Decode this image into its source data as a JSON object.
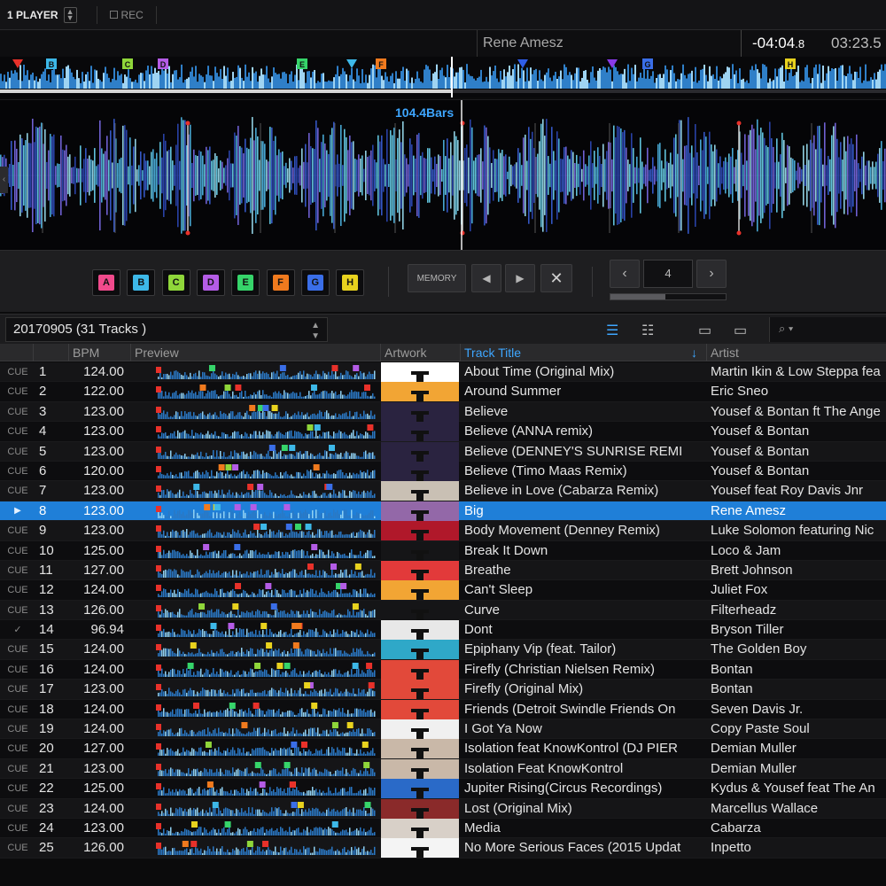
{
  "topbar": {
    "player": "1 PLAYER",
    "rec": "REC"
  },
  "deck": {
    "artist": "Rene Amesz",
    "remaining_main": "-04:04",
    "remaining_frac": ".8",
    "elapsed": "03:23.5",
    "bars_label": "104.4Bars"
  },
  "overview_markers": [
    {
      "label": "",
      "color": "#e8312a",
      "kind": "triangle"
    },
    {
      "label": "B",
      "color": "#3db8e8",
      "kind": "square"
    },
    {
      "label": "C",
      "color": "#8fd63a",
      "kind": "square"
    },
    {
      "label": "D",
      "color": "#b45ce6",
      "kind": "square"
    },
    {
      "label": "E",
      "color": "#36d46a",
      "kind": "square"
    },
    {
      "label": "",
      "color": "#3db8e8",
      "kind": "triangle"
    },
    {
      "label": "F",
      "color": "#f07a1e",
      "kind": "square"
    },
    {
      "label": "",
      "color": "#2e5de8",
      "kind": "triangle"
    },
    {
      "label": "",
      "color": "#8a3ae8",
      "kind": "triangle"
    },
    {
      "label": "G",
      "color": "#3a6ee8",
      "kind": "square"
    },
    {
      "label": "H",
      "color": "#e8d21e",
      "kind": "square"
    }
  ],
  "hotcues": [
    {
      "label": "A",
      "color": "#f04a8c"
    },
    {
      "label": "B",
      "color": "#3db8e8"
    },
    {
      "label": "C",
      "color": "#8fd63a"
    },
    {
      "label": "D",
      "color": "#b45ce6"
    },
    {
      "label": "E",
      "color": "#36d46a"
    },
    {
      "label": "F",
      "color": "#f07a1e"
    },
    {
      "label": "G",
      "color": "#3a6ee8"
    },
    {
      "label": "H",
      "color": "#e8d21e"
    }
  ],
  "memory_label": "MEMORY",
  "loop_value": "4",
  "loop_progress": 0.48,
  "browser": {
    "playlist": "20170905 (31 Tracks )",
    "search_icon": "search-icon"
  },
  "columns": {
    "bpm": "BPM",
    "preview": "Preview",
    "artwork": "Artwork",
    "title": "Track Title",
    "artist": "Artist"
  },
  "colors": {
    "accent": "#3ea6ff",
    "selected_row": "#1f7fd8"
  },
  "tracks": [
    {
      "cue": "CUE",
      "num": "1",
      "bpm": "124.00",
      "title": "About Time (Original Mix)",
      "artist": "Martin Ikin & Low Steppa fea",
      "art": "#ffffff"
    },
    {
      "cue": "CUE",
      "num": "2",
      "bpm": "122.00",
      "title": "Around Summer",
      "artist": "Eric Sneo",
      "art": "#f2a534"
    },
    {
      "cue": "CUE",
      "num": "3",
      "bpm": "123.00",
      "title": "Believe",
      "artist": "Yousef & Bontan ft The Ange",
      "art": "#2a2340"
    },
    {
      "cue": "CUE",
      "num": "4",
      "bpm": "123.00",
      "title": "Believe (ANNA remix)",
      "artist": "Yousef & Bontan",
      "art": "#2a2340"
    },
    {
      "cue": "CUE",
      "num": "5",
      "bpm": "123.00",
      "title": "Believe (DENNEY'S SUNRISE REMI",
      "artist": "Yousef & Bontan",
      "art": "#2a2340"
    },
    {
      "cue": "CUE",
      "num": "6",
      "bpm": "120.00",
      "title": "Believe (Timo Maas Remix)",
      "artist": "Yousef & Bontan",
      "art": "#2a2340"
    },
    {
      "cue": "CUE",
      "num": "7",
      "bpm": "123.00",
      "title": "Believe in Love (Cabarza Remix)",
      "artist": "Yousef feat Roy Davis Jnr",
      "art": "#c9c0b4"
    },
    {
      "cue": "▶",
      "num": "8",
      "bpm": "123.00",
      "title": "Big",
      "artist": "Rene Amesz",
      "art": "#9368a8",
      "selected": true
    },
    {
      "cue": "CUE",
      "num": "9",
      "bpm": "123.00",
      "title": "Body Movement (Denney Remix)",
      "artist": "Luke Solomon featuring Nic",
      "art": "#b0182a"
    },
    {
      "cue": "CUE",
      "num": "10",
      "bpm": "125.00",
      "title": "Break It Down",
      "artist": "Loco & Jam",
      "art": "#151517"
    },
    {
      "cue": "CUE",
      "num": "11",
      "bpm": "127.00",
      "title": "Breathe",
      "artist": "Brett Johnson",
      "art": "#e23a3a"
    },
    {
      "cue": "CUE",
      "num": "12",
      "bpm": "124.00",
      "title": "Can't Sleep",
      "artist": "Juliet Fox",
      "art": "#f2a534"
    },
    {
      "cue": "CUE",
      "num": "13",
      "bpm": "126.00",
      "title": "Curve",
      "artist": "Filterheadz",
      "art": "#151517"
    },
    {
      "cue": "✓",
      "num": "14",
      "bpm": "96.94",
      "title": "Dont",
      "artist": "Bryson Tiller",
      "art": "#e8e8e8"
    },
    {
      "cue": "CUE",
      "num": "15",
      "bpm": "124.00",
      "title": "Epiphany Vip (feat. Tailor)",
      "artist": "The Golden Boy",
      "art": "#2fa8c8"
    },
    {
      "cue": "CUE",
      "num": "16",
      "bpm": "124.00",
      "title": "Firefly (Christian Nielsen Remix)",
      "artist": "Bontan",
      "art": "#e2493a"
    },
    {
      "cue": "CUE",
      "num": "17",
      "bpm": "123.00",
      "title": "Firefly (Original Mix)",
      "artist": "Bontan",
      "art": "#e2493a"
    },
    {
      "cue": "CUE",
      "num": "18",
      "bpm": "124.00",
      "title": "Friends (Detroit Swindle Friends On",
      "artist": "Seven Davis Jr.",
      "art": "#e2493a"
    },
    {
      "cue": "CUE",
      "num": "19",
      "bpm": "124.00",
      "title": "I Got Ya Now",
      "artist": "Copy Paste Soul",
      "art": "#f0f0f0"
    },
    {
      "cue": "CUE",
      "num": "20",
      "bpm": "127.00",
      "title": "Isolation feat KnowKontrol (DJ PIER",
      "artist": "Demian Muller",
      "art": "#c9b8a8"
    },
    {
      "cue": "CUE",
      "num": "21",
      "bpm": "123.00",
      "title": "Isolation Feat KnowKontrol",
      "artist": "Demian Muller",
      "art": "#c9b8a8"
    },
    {
      "cue": "CUE",
      "num": "22",
      "bpm": "125.00",
      "title": "Jupiter Rising(Circus Recordings)",
      "artist": "Kydus & Yousef feat The An",
      "art": "#2a6ac8"
    },
    {
      "cue": "CUE",
      "num": "23",
      "bpm": "124.00",
      "title": "Lost (Original Mix)",
      "artist": "Marcellus Wallace",
      "art": "#8a2a2a"
    },
    {
      "cue": "CUE",
      "num": "24",
      "bpm": "123.00",
      "title": "Media",
      "artist": "Cabarza",
      "art": "#d8d0c8"
    },
    {
      "cue": "CUE",
      "num": "25",
      "bpm": "126.00",
      "title": "No More Serious Faces (2015 Updat",
      "artist": "Inpetto",
      "art": "#f4f4f4"
    }
  ]
}
